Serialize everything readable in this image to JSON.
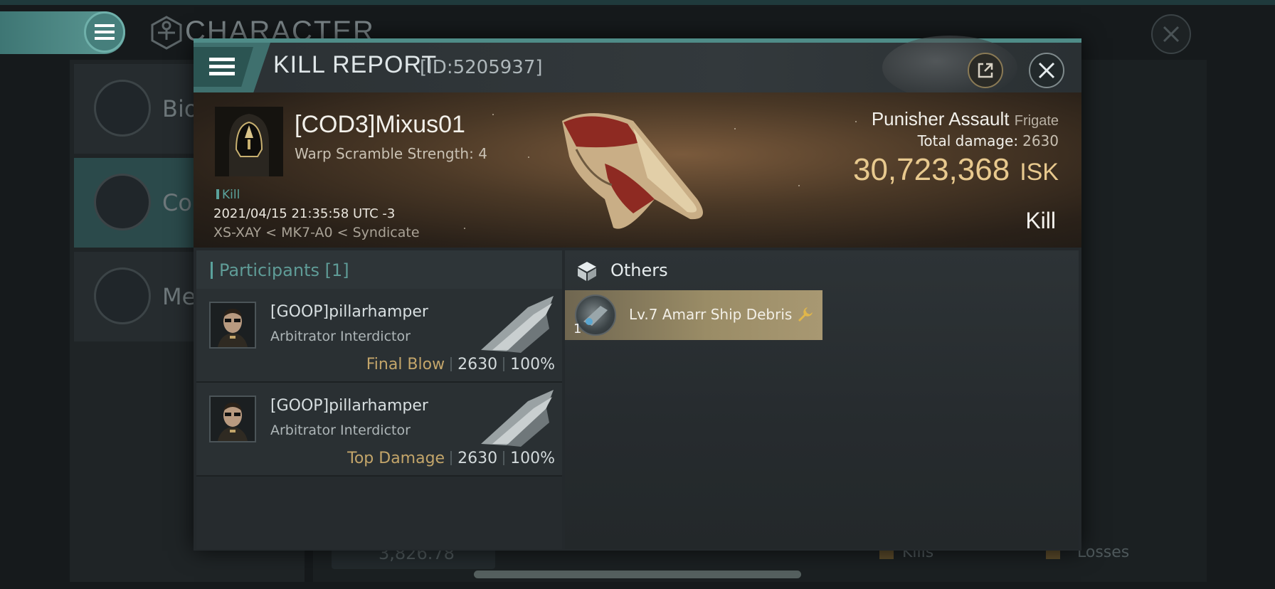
{
  "background": {
    "title": "CHARACTER",
    "sidebar": [
      {
        "label": "Bio"
      },
      {
        "label": "Con"
      },
      {
        "label": "Med"
      }
    ],
    "stat_value": "3,826.78",
    "kills_label": "Kills",
    "losses_label": "Losses"
  },
  "dialog": {
    "title": "KILL REPORT",
    "id": "[ID:5205937]",
    "victim": {
      "name": "[COD3]Mixus01",
      "warp_scramble": "Warp Scramble Strength: 4",
      "kill_tag": "Kill",
      "datetime": "2021/04/15 21:35:58 UTC -3",
      "location": "XS-XAY < MK7-A0 < Syndicate"
    },
    "ship": {
      "name": "Punisher Assault",
      "class": "Frigate",
      "total_damage_label": "Total damage:",
      "total_damage": "2630",
      "isk_value": "30,723,368",
      "isk_unit": "ISK",
      "result": "Kill"
    },
    "participants": {
      "title": "Participants [1]",
      "rows": [
        {
          "name": "[GOOP]pillarhamper",
          "ship": "Arbitrator Interdictor",
          "tag": "Final Blow",
          "damage": "2630",
          "percent": "100%"
        },
        {
          "name": "[GOOP]pillarhamper",
          "ship": "Arbitrator Interdictor",
          "tag": "Top Damage",
          "damage": "2630",
          "percent": "100%"
        }
      ]
    },
    "others": {
      "title": "Others",
      "items": [
        {
          "quantity": "1",
          "name": "Lv.7 Amarr Ship Debris"
        }
      ]
    }
  },
  "colors": {
    "accent": "#5aa29c",
    "gold": "#e8c98e",
    "tag_gold": "#c3a56a"
  }
}
